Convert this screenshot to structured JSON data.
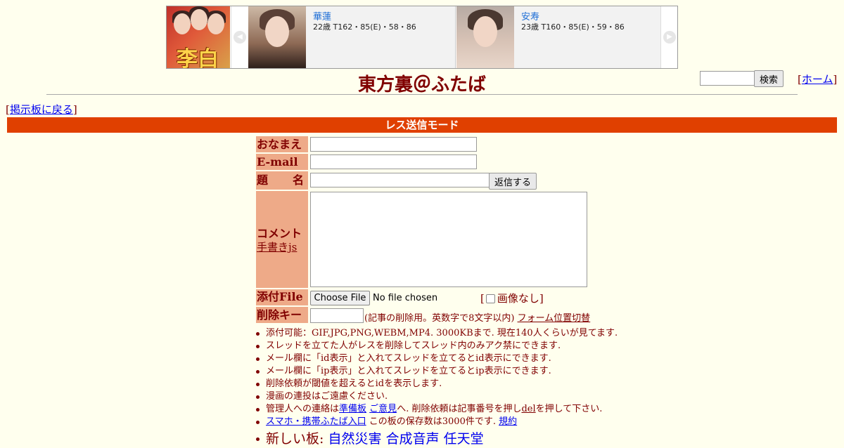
{
  "banner": {
    "logo_text": "李白",
    "cards": [
      {
        "name": "華蓮",
        "stats": "22歳 T162・85(E)・58・86"
      },
      {
        "name": "安寿",
        "stats": "23歳 T160・85(E)・59・86"
      }
    ]
  },
  "header": {
    "title": "東方裏＠ふたば",
    "search_button": "検索",
    "home_link": "ホーム",
    "back_link": "掲示板に戻る"
  },
  "mode_bar": "レス送信モード",
  "form": {
    "labels": {
      "name": "おなまえ",
      "email": "E-mail",
      "subject_a": "題",
      "subject_b": "名",
      "comment": "コメント",
      "handwriting": "手書きjs",
      "file": "添付File",
      "delkey": "削除キー"
    },
    "reply_button": "返信する",
    "file_button": "Choose File",
    "file_status": "No file chosen",
    "no_image": "画像なし",
    "delkey_note": "(記事の削除用。英数字で8文字以内)",
    "form_toggle": "フォーム位置切替"
  },
  "notes": {
    "n1": "添付可能：GIF,JPG,PNG,WEBM,MP4. 3000KBまで. 現在140人くらいが見てます.",
    "n2": "スレッドを立てた人がレスを削除してスレッド内のみアク禁にできます.",
    "n3": "メール欄に「id表示」と入れてスレッドを立てるとid表示にできます.",
    "n4": "メール欄に「ip表示」と入れてスレッドを立てるとip表示にできます.",
    "n5": "削除依頼が閾値を超えるとidを表示します.",
    "n6": "漫画の連投はご遠慮ください.",
    "n7_a": "管理人への連絡は",
    "n7_link1": "準備板",
    "n7_link2": "ご意見",
    "n7_b": "へ. 削除依頼は記事番号を押し",
    "n7_del": "del",
    "n7_c": "を押して下さい.",
    "n8_link": "スマホ・携帯ふたば入口",
    "n8_text": " この板の保存数は3000件です.",
    "n8_rules": "規約",
    "n9_label": "新しい板:",
    "n9_boards": [
      "自然災害",
      "合成音声",
      "任天堂"
    ]
  }
}
